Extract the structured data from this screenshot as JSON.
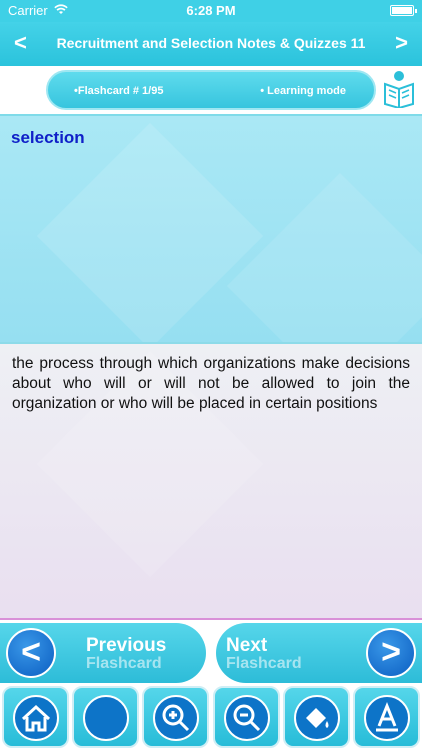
{
  "status_bar": {
    "carrier": "Carrier",
    "time": "6:28 PM"
  },
  "nav": {
    "title": "Recruitment and Selection Notes & Quizzes 11",
    "back_icon": "chevron-left-icon",
    "forward_icon": "chevron-right-icon"
  },
  "info": {
    "flashcard": "•Flashcard #  1/95",
    "mode": "• Learning mode"
  },
  "card": {
    "term": "selection",
    "definition": "the process through which organizations make decisions about who will or will not be allowed to join the organization or who will be placed in certain positions"
  },
  "buttons": {
    "previous": {
      "line1": "Previous",
      "line2": "Flashcard"
    },
    "next": {
      "line1": "Next",
      "line2": "Flashcard"
    }
  },
  "toolbar": [
    "home-icon",
    "blank-circle-icon",
    "zoom-in-icon",
    "zoom-out-icon",
    "paint-bucket-icon",
    "font-icon"
  ]
}
